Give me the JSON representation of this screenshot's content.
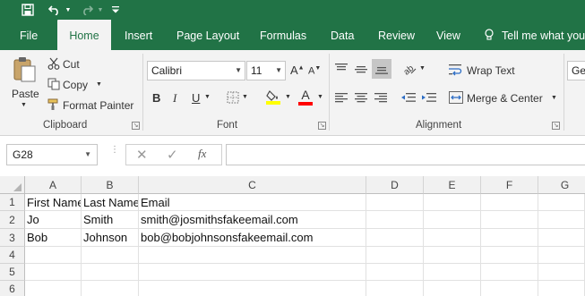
{
  "titlebar": {
    "save_icon": "save-icon",
    "undo_icon": "undo-icon",
    "redo_icon": "redo-icon",
    "customize_icon": "customize-quick-access-icon"
  },
  "tabs": [
    {
      "label": "File"
    },
    {
      "label": "Home"
    },
    {
      "label": "Insert"
    },
    {
      "label": "Page Layout"
    },
    {
      "label": "Formulas"
    },
    {
      "label": "Data"
    },
    {
      "label": "Review"
    },
    {
      "label": "View"
    },
    {
      "label": "Tell me what you"
    }
  ],
  "ribbon": {
    "clipboard": {
      "paste": "Paste",
      "cut": "Cut",
      "copy": "Copy",
      "format_painter": "Format Painter",
      "label": "Clipboard"
    },
    "font": {
      "font_name": "Calibri",
      "font_size": "11",
      "bold": "B",
      "italic": "I",
      "underline": "U",
      "font_color_glyph": "A",
      "label": "Font"
    },
    "alignment": {
      "wrap_text": "Wrap Text",
      "merge_center": "Merge & Center",
      "label": "Alignment"
    },
    "number": {
      "format_partial": "Ge"
    }
  },
  "formula_bar": {
    "name_box": "G28",
    "fx": "fx",
    "content": ""
  },
  "columns": [
    "A",
    "B",
    "C",
    "D",
    "E",
    "F",
    "G"
  ],
  "rows": [
    {
      "num": "1",
      "cells": [
        "First Name",
        "Last Name",
        "Email",
        "",
        "",
        "",
        ""
      ]
    },
    {
      "num": "2",
      "cells": [
        "Jo",
        "Smith",
        "smith@josmithsfakeemail.com",
        "",
        "",
        "",
        ""
      ]
    },
    {
      "num": "3",
      "cells": [
        "Bob",
        "Johnson",
        "bob@bobjohnsonsfakeemail.com",
        "",
        "",
        "",
        ""
      ]
    },
    {
      "num": "4",
      "cells": [
        "",
        "",
        "",
        "",
        "",
        "",
        ""
      ]
    },
    {
      "num": "5",
      "cells": [
        "",
        "",
        "",
        "",
        "",
        "",
        ""
      ]
    },
    {
      "num": "6",
      "cells": [
        "",
        "",
        "",
        "",
        "",
        "",
        ""
      ]
    }
  ],
  "colors": {
    "excel_green": "#217346",
    "ribbon_bg": "#f3f3f3",
    "highlight_yellow": "#ffff00",
    "font_red": "#ff0000"
  }
}
